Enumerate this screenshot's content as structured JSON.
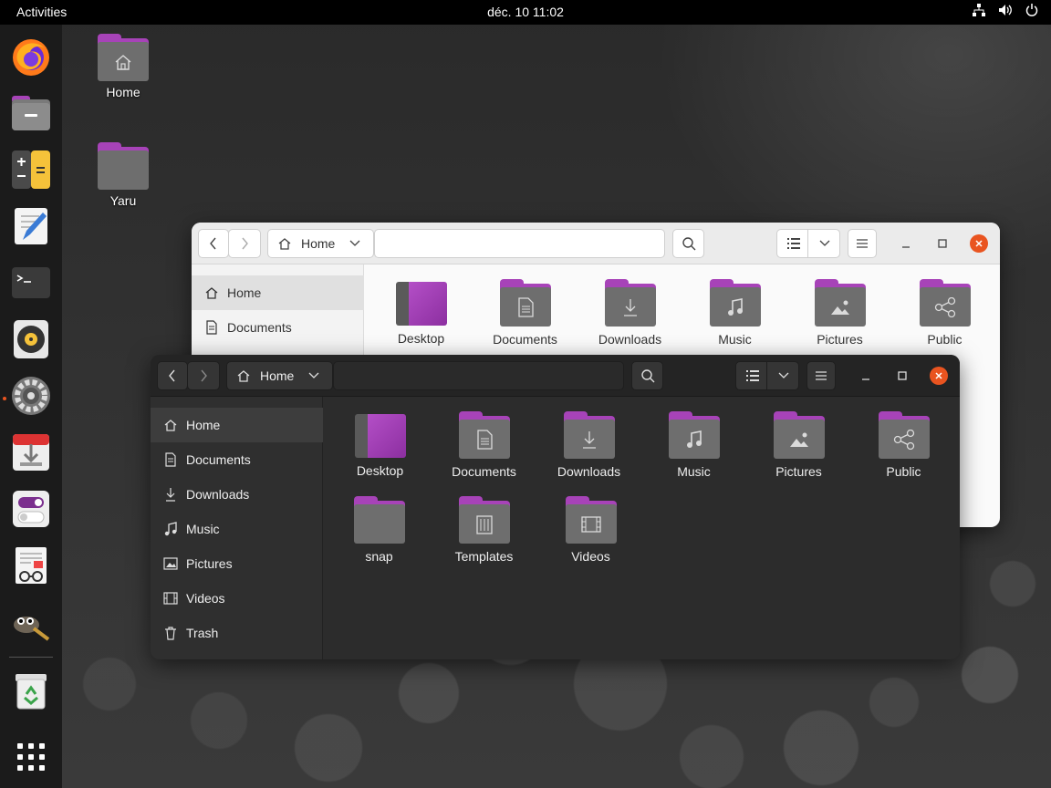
{
  "topbar": {
    "activities": "Activities",
    "clock": "déc. 10  11:02",
    "tray_icons": [
      "network-icon",
      "volume-icon",
      "power-icon"
    ]
  },
  "dock": {
    "apps": [
      "Firefox",
      "Files",
      "Calculator",
      "Text Editor",
      "Terminal",
      "Rhythmbox",
      "Settings",
      "Software Updater",
      "Tweaks",
      "Document Viewer",
      "GIMP",
      "Trash"
    ],
    "accent": "#e95420"
  },
  "desktop": {
    "icons": [
      {
        "label": "Home"
      },
      {
        "label": "Yaru"
      }
    ]
  },
  "light_window": {
    "path_label": "Home",
    "sidebar": [
      {
        "label": "Home"
      },
      {
        "label": "Documents"
      }
    ],
    "files": [
      {
        "label": "Desktop"
      },
      {
        "label": "Documents"
      },
      {
        "label": "Downloads"
      },
      {
        "label": "Music"
      },
      {
        "label": "Pictures"
      },
      {
        "label": "Public"
      }
    ]
  },
  "dark_window": {
    "path_label": "Home",
    "sidebar": [
      {
        "label": "Home"
      },
      {
        "label": "Documents"
      },
      {
        "label": "Downloads"
      },
      {
        "label": "Music"
      },
      {
        "label": "Pictures"
      },
      {
        "label": "Videos"
      },
      {
        "label": "Trash"
      }
    ],
    "files": [
      {
        "label": "Desktop"
      },
      {
        "label": "Documents"
      },
      {
        "label": "Downloads"
      },
      {
        "label": "Music"
      },
      {
        "label": "Pictures"
      },
      {
        "label": "Public"
      },
      {
        "label": "snap"
      },
      {
        "label": "Templates"
      },
      {
        "label": "Videos"
      }
    ]
  },
  "colors": {
    "folder_tab": "#a743b8",
    "folder_body": "#6e6e6e",
    "close_button": "#e95420"
  }
}
